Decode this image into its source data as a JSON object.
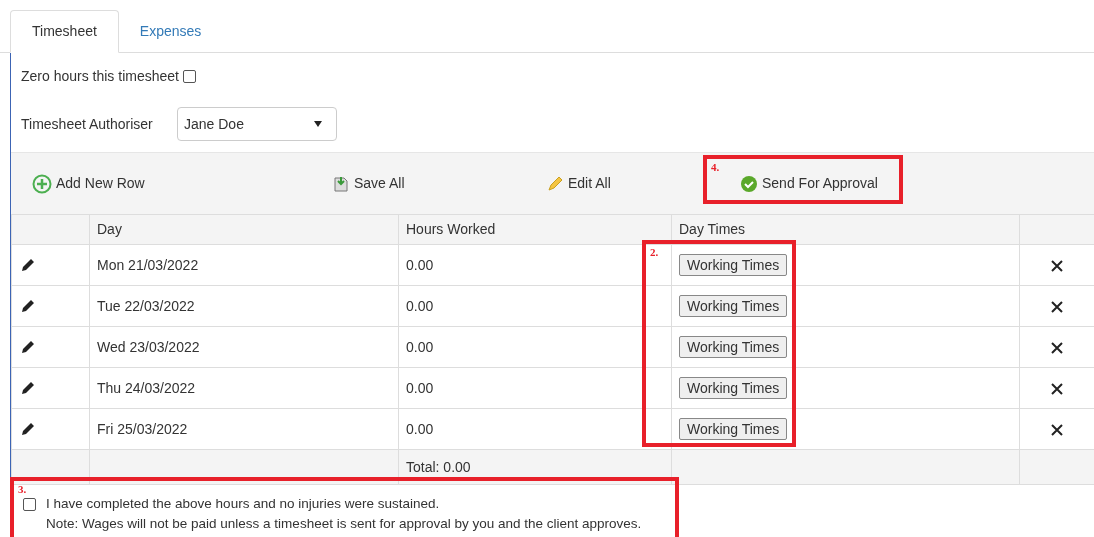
{
  "tabs": [
    {
      "label": "Timesheet",
      "selected": true
    },
    {
      "label": "Expenses",
      "selected": false
    }
  ],
  "zero_hours": {
    "label": "Zero hours this timesheet",
    "checked": false
  },
  "authoriser": {
    "label": "Timesheet Authoriser",
    "value": "Jane Doe"
  },
  "toolbar": [
    {
      "kind": "add",
      "label": "Add New Row"
    },
    {
      "kind": "save",
      "label": "Save All"
    },
    {
      "kind": "edit",
      "label": "Edit All"
    },
    {
      "kind": "send",
      "label": "Send For Approval"
    }
  ],
  "table": {
    "columns": [
      "Day",
      "Hours Worked",
      "Day Times"
    ],
    "rows": [
      {
        "day": "Mon 21/03/2022",
        "hours": "0.00",
        "action": "Working Times"
      },
      {
        "day": "Tue 22/03/2022",
        "hours": "0.00",
        "action": "Working Times"
      },
      {
        "day": "Wed 23/03/2022",
        "hours": "0.00",
        "action": "Working Times"
      },
      {
        "day": "Thu 24/03/2022",
        "hours": "0.00",
        "action": "Working Times"
      },
      {
        "day": "Fri 25/03/2022",
        "hours": "0.00",
        "action": "Working Times"
      }
    ],
    "total": "Total: 0.00"
  },
  "declaration": {
    "label": "I have completed the above hours and no injuries were sustained.",
    "checked": false,
    "note": "Note: Wages will not be paid unless a timesheet is sent for approval by you and the client approves."
  },
  "annotations": [
    {
      "label": "4."
    },
    {
      "label": "2."
    },
    {
      "label": "3."
    }
  ]
}
